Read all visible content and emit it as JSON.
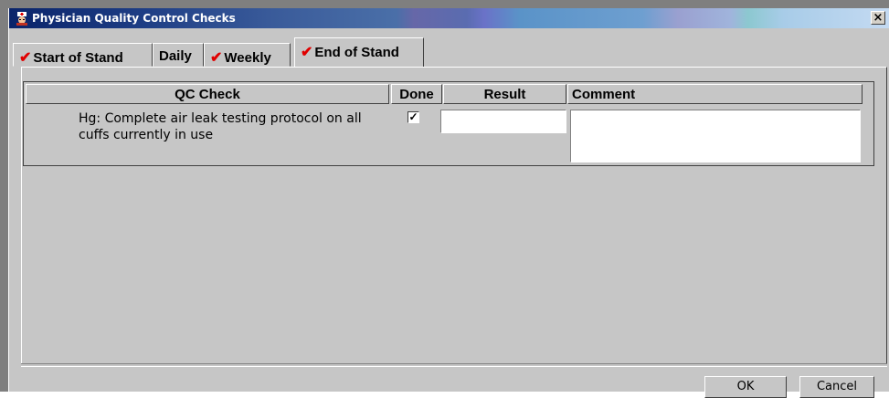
{
  "window": {
    "title": "Physician Quality Control Checks",
    "close_label": "×"
  },
  "tabs": [
    {
      "label": "Start of Stand",
      "checked": true,
      "active": false
    },
    {
      "label": "Daily",
      "checked": false,
      "active": false
    },
    {
      "label": "Weekly",
      "checked": true,
      "active": false
    },
    {
      "label": "End of Stand",
      "checked": true,
      "active": true
    }
  ],
  "grid": {
    "headers": {
      "qc_check": "QC Check",
      "done": "Done",
      "result": "Result",
      "comment": "Comment"
    },
    "rows": [
      {
        "qc_check": "Hg:  Complete air leak testing protocol on all cuffs currently in use",
        "done_mark": "✓",
        "result": "",
        "comment": ""
      }
    ]
  },
  "buttons": {
    "ok": "OK",
    "cancel": "Cancel"
  },
  "colors": {
    "check_red": "#e00000",
    "titlebar_start": "#0a246a",
    "face": "#c6c6c6"
  },
  "icons": {
    "app": "app-doctor-icon",
    "close": "close-icon",
    "checkmark": "checkmark-icon"
  }
}
